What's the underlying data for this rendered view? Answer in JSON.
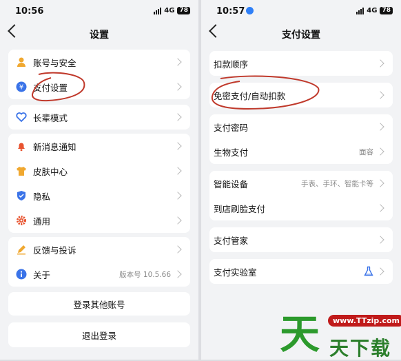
{
  "left": {
    "status": {
      "time": "10:56",
      "network": "4G",
      "battery": "78"
    },
    "title": "设置",
    "groups": [
      [
        {
          "label": "账号与安全",
          "icon": "person-icon"
        },
        {
          "label": "支付设置",
          "icon": "yuan-icon"
        }
      ],
      [
        {
          "label": "长辈模式",
          "icon": "heart-icon"
        }
      ],
      [
        {
          "label": "新消息通知",
          "icon": "bell-icon"
        },
        {
          "label": "皮肤中心",
          "icon": "shirt-icon"
        },
        {
          "label": "隐私",
          "icon": "shield-icon"
        },
        {
          "label": "通用",
          "icon": "gear-icon"
        }
      ],
      [
        {
          "label": "反馈与投诉",
          "icon": "pencil-icon"
        },
        {
          "label": "关于",
          "icon": "info-icon",
          "value": "版本号 10.5.66"
        }
      ]
    ],
    "login_other": "登录其他账号",
    "logout": "退出登录"
  },
  "right": {
    "status": {
      "time": "10:57",
      "network": "4G",
      "battery": "78"
    },
    "title": "支付设置",
    "groups": [
      [
        {
          "label": "扣款顺序"
        }
      ],
      [
        {
          "label": "免密支付/自动扣款"
        }
      ],
      [
        {
          "label": "支付密码"
        },
        {
          "label": "生物支付",
          "value": "面容"
        }
      ],
      [
        {
          "label": "智能设备",
          "value": "手表、手环、智能卡等"
        },
        {
          "label": "到店刷脸支付"
        }
      ],
      [
        {
          "label": "支付管家"
        }
      ],
      [
        {
          "label": "支付实验室",
          "icon": "flask-icon"
        }
      ]
    ]
  },
  "watermark": {
    "url": "www.TTzip.com",
    "big": "天",
    "text": "天下载"
  },
  "colors": {
    "annotation": "#c0392b",
    "accent": "#2f7ff7"
  }
}
